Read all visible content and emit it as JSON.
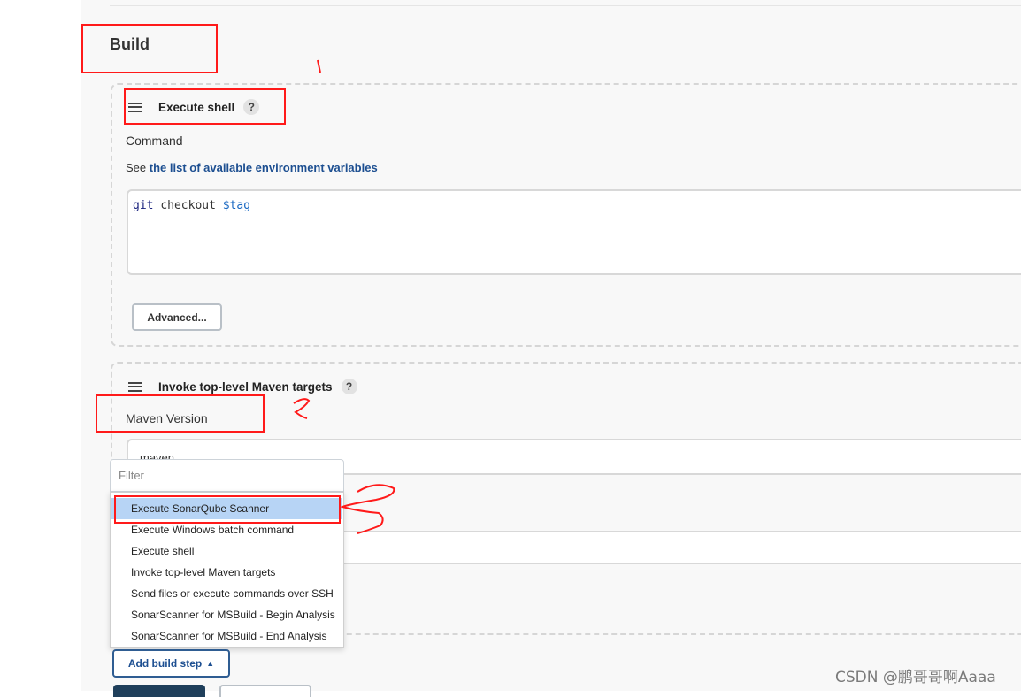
{
  "section": {
    "title": "Build"
  },
  "steps": [
    {
      "title": "Execute shell",
      "help": "?",
      "command_label": "Command",
      "see_prefix": "See ",
      "see_link": "the list of available environment variables",
      "code": {
        "cmd": "git",
        "arg": "checkout",
        "var": "$tag"
      },
      "advanced_label": "Advanced..."
    },
    {
      "title": "Invoke top-level Maven targets",
      "help": "?",
      "maven_label": "Maven Version",
      "maven_value": "maven"
    }
  ],
  "dropdown": {
    "filter_placeholder": "Filter",
    "items": [
      "Execute SonarQube Scanner",
      "Execute Windows batch command",
      "Execute shell",
      "Invoke top-level Maven targets",
      "Send files or execute commands over SSH",
      "SonarScanner for MSBuild - Begin Analysis",
      "SonarScanner for MSBuild - End Analysis"
    ],
    "selected_index": 0
  },
  "add_build_step": {
    "label": "Add build step",
    "caret": "▲"
  },
  "watermark": "CSDN @鹏哥哥啊Aaaa",
  "colors": {
    "annotation": "#ff1a1a",
    "link": "#1d4f91",
    "selected": "#b7d4f5"
  }
}
